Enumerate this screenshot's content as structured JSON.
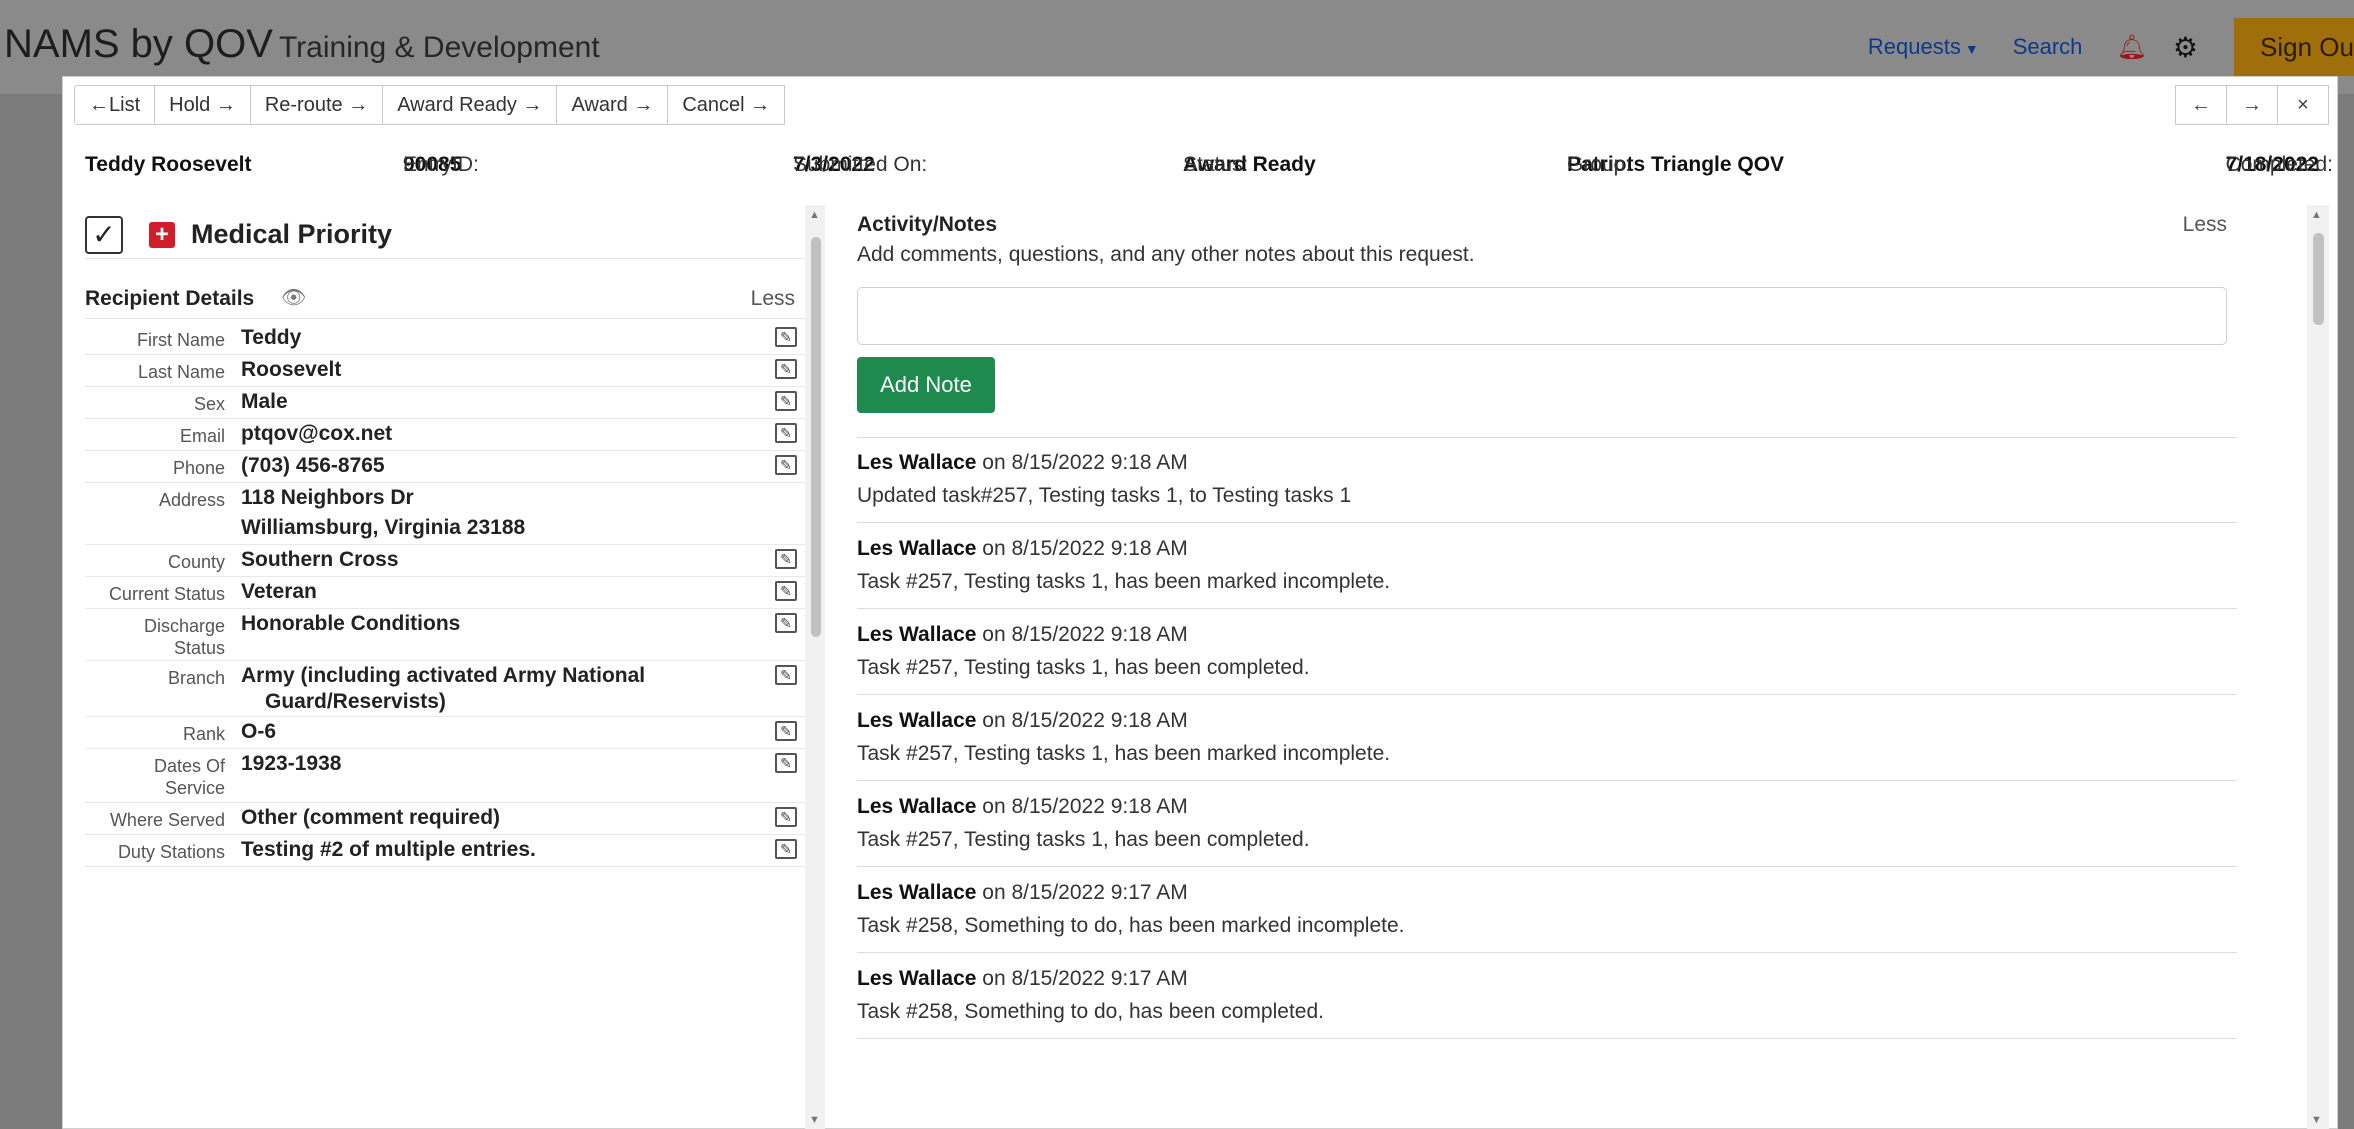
{
  "navbar": {
    "brand": "NAMS by QOV",
    "subtitle": "Training & Development",
    "requests_label": "Requests",
    "search_label": "Search",
    "signout_label": "Sign Out"
  },
  "toolbar": {
    "list": "←List",
    "hold": "Hold →",
    "reroute": "Re-route →",
    "award_ready": "Award Ready →",
    "award": "Award →",
    "cancel": "Cancel →",
    "prev": "←",
    "next": "→",
    "close": "×"
  },
  "summary": {
    "name": "Teddy Roosevelt",
    "entry_label": "EntryID:",
    "entry_id": "90085",
    "submitted_label": "Submitted On:",
    "submitted": "7/3/2022",
    "status_label": "Status:",
    "status": "Award Ready",
    "group_label": "Group:",
    "group": "Patriots Triangle QOV",
    "completed_label": "Completed:",
    "completed": "7/18/2022"
  },
  "medical": {
    "label": "Medical Priority"
  },
  "recipient": {
    "title": "Recipient Details",
    "less": "Less",
    "rows": [
      {
        "key": "First Name",
        "value": "Teddy"
      },
      {
        "key": "Last Name",
        "value": "Roosevelt"
      },
      {
        "key": "Sex",
        "value": "Male"
      },
      {
        "key": "Email",
        "value": "ptqov@cox.net"
      },
      {
        "key": "Phone",
        "value": "(703) 456-8765"
      },
      {
        "key": "Address",
        "value": "118 Neighbors Dr",
        "value2": "Williamsburg, Virginia 23188"
      },
      {
        "key": "County",
        "value": "Southern Cross"
      },
      {
        "key": "Current Status",
        "value": "Veteran"
      },
      {
        "key": "Discharge",
        "key2": "Status",
        "value": "Honorable Conditions"
      },
      {
        "key": "Branch",
        "value": "Army (including activated Army National",
        "value2": "Guard/Reservists)"
      },
      {
        "key": "Rank",
        "value": "O-6"
      },
      {
        "key": "Dates Of",
        "key2": "Service",
        "value": "1923-1938"
      },
      {
        "key": "Where Served",
        "value": "Other (comment required)"
      },
      {
        "key": "Duty Stations",
        "value": "Testing #2 of multiple entries."
      }
    ]
  },
  "activity": {
    "title": "Activity/Notes",
    "less": "Less",
    "description": "Add comments, questions, and any other notes about this request.",
    "input_placeholder": "",
    "add_note": "Add Note",
    "notes": [
      {
        "author": "Les Wallace",
        "when": " on 8/15/2022 9:18 AM",
        "text": "Updated task#257, Testing tasks 1, to Testing tasks 1"
      },
      {
        "author": "Les Wallace",
        "when": " on 8/15/2022 9:18 AM",
        "text": "Task #257, Testing tasks 1, has been marked incomplete."
      },
      {
        "author": "Les Wallace",
        "when": " on 8/15/2022 9:18 AM",
        "text": "Task #257, Testing tasks 1, has been completed."
      },
      {
        "author": "Les Wallace",
        "when": " on 8/15/2022 9:18 AM",
        "text": "Task #257, Testing tasks 1, has been marked incomplete."
      },
      {
        "author": "Les Wallace",
        "when": " on 8/15/2022 9:18 AM",
        "text": "Task #257, Testing tasks 1, has been completed."
      },
      {
        "author": "Les Wallace",
        "when": " on 8/15/2022 9:17 AM",
        "text": "Task #258, Something to do, has been marked incomplete."
      },
      {
        "author": "Les Wallace",
        "when": " on 8/15/2022 9:17 AM",
        "text": "Task #258, Something to do, has been completed."
      }
    ]
  },
  "colors": {
    "accent_link": "#0b3a8a",
    "add_note_button": "#1e8a4d",
    "medical_red": "#d11d2a",
    "signout_bg": "#a06e0a"
  },
  "icons": {
    "bell": "bell-icon",
    "gear": "gear-icon",
    "eye": "eye-icon",
    "edit": "edit-icon",
    "check": "checkbox-icon",
    "medical": "medical-cross-icon"
  }
}
